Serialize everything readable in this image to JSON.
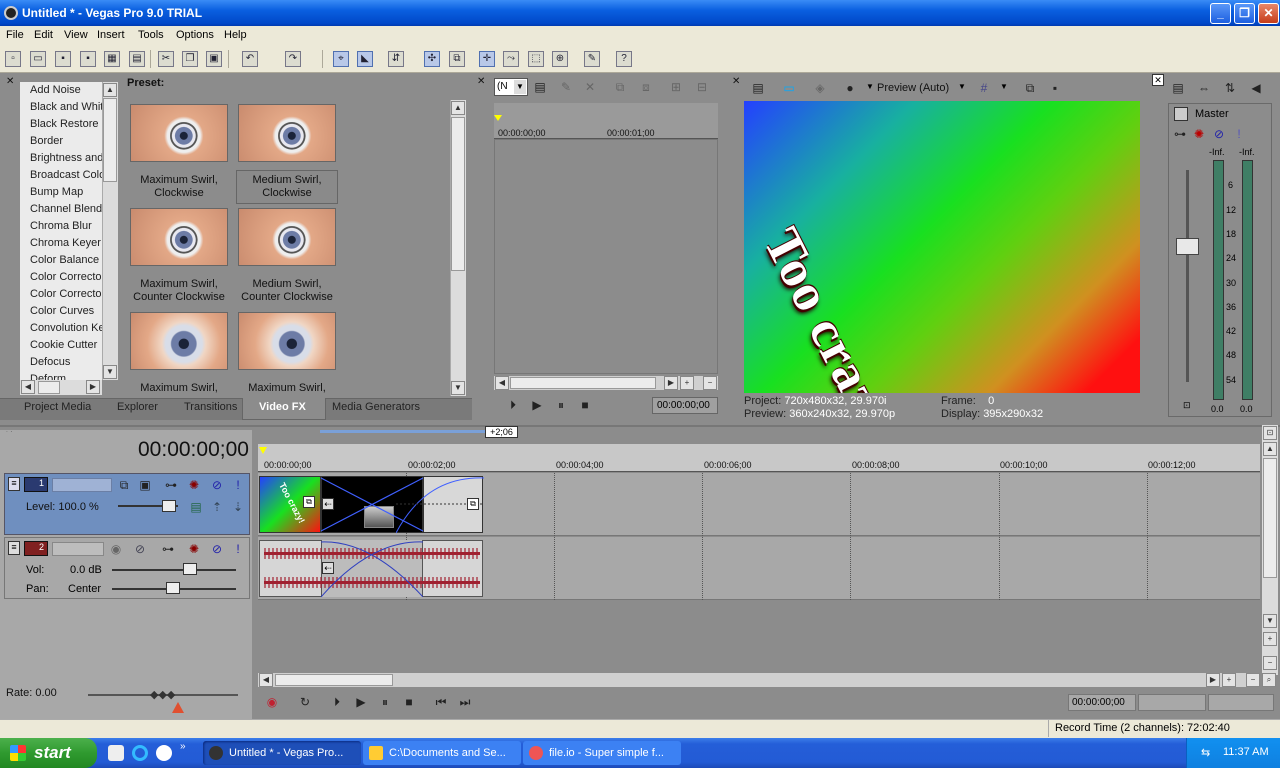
{
  "window": {
    "title": "Untitled * - Vegas Pro 9.0 TRIAL"
  },
  "menu": [
    "File",
    "Edit",
    "View",
    "Insert",
    "Tools",
    "Options",
    "Help"
  ],
  "fx_list": [
    "Add Noise",
    "Black and White",
    "Black Restore",
    "Border",
    "Brightness and",
    "Broadcast Colo",
    "Bump Map",
    "Channel Blend",
    "Chroma Blur",
    "Chroma Keyer",
    "Color Balance",
    "Color Correcto",
    "Color Correcto",
    "Color Curves",
    "Convolution Ke",
    "Cookie Cutter",
    "Defocus",
    "Deform"
  ],
  "preset_label": "Preset:",
  "presets": [
    {
      "line1": "Maximum Swirl,",
      "line2": "Clockwise"
    },
    {
      "line1": "Medium Swirl,",
      "line2": "Clockwise"
    },
    {
      "line1": "Maximum Swirl,",
      "line2": "Counter Clockwise"
    },
    {
      "line1": "Medium Swirl,",
      "line2": "Counter Clockwise"
    },
    {
      "line1": "Maximum Swirl,",
      "line2": ""
    },
    {
      "line1": "Maximum Swirl,",
      "line2": ""
    }
  ],
  "tabs": [
    "Project Media",
    "Explorer",
    "Transitions",
    "Video FX",
    "Media Generators"
  ],
  "trimmer": {
    "combo": "(N",
    "t0": "00:00:00;00",
    "t1": "00:00:01;00",
    "time": "00:00:00;00"
  },
  "preview": {
    "mode": "Preview (Auto)",
    "text": "Too crazy!",
    "project_label": "Project:",
    "project": "720x480x32, 29.970i",
    "preview_label": "Preview:",
    "preview": "360x240x32, 29.970p",
    "frame_label": "Frame:",
    "frame": "0",
    "display_label": "Display:",
    "display": "395x290x32"
  },
  "master": {
    "label": "Master",
    "left_peak": "-Inf.",
    "right_peak": "-Inf.",
    "scale": [
      "6",
      "12",
      "18",
      "24",
      "30",
      "36",
      "42",
      "48",
      "54"
    ],
    "left_val": "0.0",
    "right_val": "0.0"
  },
  "timeline": {
    "time": "00:00:00;00",
    "marker": "+2;06",
    "ticks": [
      "00:00:00;00",
      "00:00:02;00",
      "00:00:04;00",
      "00:00:06;00",
      "00:00:08;00",
      "00:00:10;00",
      "00:00:12;00"
    ],
    "clip_text": "Too crazy!"
  },
  "track1": {
    "num": "1",
    "level": "Level: 100.0 %"
  },
  "track2": {
    "num": "2",
    "vol_label": "Vol:",
    "vol": "0.0 dB",
    "pan_label": "Pan:",
    "pan": "Center"
  },
  "transport": {
    "rate": "Rate: 0.00",
    "time": "00:00:00;00",
    "record_time": "Record Time (2 channels): 72:02:40"
  },
  "taskbar": {
    "start": "start",
    "tasks": [
      "Untitled * - Vegas Pro...",
      "C:\\Documents and Se...",
      "file.io - Super simple f..."
    ],
    "clock": "11:37 AM"
  },
  "colors": {
    "titlebar": "#0a5fe0",
    "panel": "#8c8c8c",
    "track_header": "#6f8fbf",
    "taskbar": "#245ed8",
    "start": "#2f9a2f"
  }
}
